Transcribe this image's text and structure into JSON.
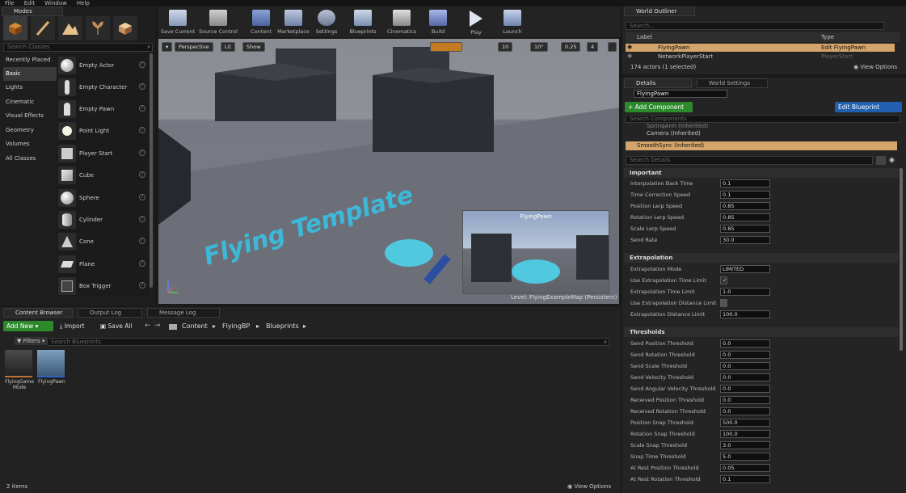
{
  "menubar": [
    "File",
    "Edit",
    "Window",
    "Help"
  ],
  "modes": {
    "tab": "Modes",
    "search_placeholder": "Search Classes",
    "categories": [
      "Recently Placed",
      "Basic",
      "Lights",
      "Cinematic",
      "Visual Effects",
      "Geometry",
      "Volumes",
      "All Classes"
    ],
    "items": [
      "Empty Actor",
      "Empty Character",
      "Empty Pawn",
      "Point Light",
      "Player Start",
      "Cube",
      "Sphere",
      "Cylinder",
      "Cone",
      "Plane",
      "Box Trigger"
    ]
  },
  "toolbar": [
    "Save Current",
    "Source Control",
    "Content",
    "Marketplace",
    "Settings",
    "Blueprints",
    "Cinematics",
    "Build",
    "Play",
    "Launch"
  ],
  "viewport": {
    "perspective": "Perspective",
    "lit": "Lit",
    "show": "Show",
    "grid": "10",
    "angle": "10°",
    "scale": "0.25",
    "cam": "4",
    "floor_text": "Flying Template",
    "pip_title": "FlyingPawn",
    "level_label": "Level:  FlyingExampleMap (Persistent)"
  },
  "outliner": {
    "tab": "World Outliner",
    "search_placeholder": "Search...",
    "col_label": "Label",
    "col_type": "Type",
    "rows": [
      {
        "label": "FlyingPawn",
        "type": "Edit FlyingPawn"
      },
      {
        "label": "NetworkPlayerStart",
        "type": "PlayerStart"
      }
    ],
    "count": "174 actors (1 selected)",
    "view_options": "View Options"
  },
  "details": {
    "tab": "Details",
    "tab2": "World Settings",
    "name": "FlyingPawn",
    "add_component": "+ Add Component",
    "edit_blueprint": "Edit Blueprint",
    "search_components": "Search Components",
    "components": [
      "SpringArm (Inherited)",
      "Camera (Inherited)",
      "SmoothSync (Inherited)"
    ],
    "search_details": "Search Details",
    "sections": {
      "important": "Important",
      "extrapolation": "Extrapolation",
      "thresholds": "Thresholds"
    },
    "important": [
      {
        "label": "Interpolation Back Time",
        "value": "0.1"
      },
      {
        "label": "Time Correction Speed",
        "value": "0.1"
      },
      {
        "label": "Position Lerp Speed",
        "value": "0.85"
      },
      {
        "label": "Rotation Lerp Speed",
        "value": "0.85"
      },
      {
        "label": "Scale Lerp Speed",
        "value": "0.85"
      },
      {
        "label": "Send Rate",
        "value": "30.0"
      }
    ],
    "extrapolation": [
      {
        "label": "Extrapolation Mode",
        "value": "LIMITED"
      },
      {
        "label": "Use Extrapolation Time Limit",
        "value": ""
      },
      {
        "label": "Extrapolation Time Limit",
        "value": "1.0"
      },
      {
        "label": "Use Extrapolation Distance Limit",
        "value": ""
      },
      {
        "label": "Extrapolation Distance Limit",
        "value": "100.0"
      }
    ],
    "thresholds": [
      {
        "label": "Send Position Threshold",
        "value": "0.0"
      },
      {
        "label": "Send Rotation Threshold",
        "value": "0.0"
      },
      {
        "label": "Send Scale Threshold",
        "value": "0.0"
      },
      {
        "label": "Send Velocity Threshold",
        "value": "0.0"
      },
      {
        "label": "Send Angular Velocity Threshold",
        "value": "0.0"
      },
      {
        "label": "Received Position Threshold",
        "value": "0.0"
      },
      {
        "label": "Received Rotation Threshold",
        "value": "0.0"
      },
      {
        "label": "Position Snap Threshold",
        "value": "500.0"
      },
      {
        "label": "Rotation Snap Threshold",
        "value": "100.0"
      },
      {
        "label": "Scale Snap Threshold",
        "value": "3.0"
      },
      {
        "label": "Snap Time Threshold",
        "value": "5.0"
      },
      {
        "label": "At Rest Position Threshold",
        "value": "0.05"
      },
      {
        "label": "At Rest Rotation Threshold",
        "value": "0.1"
      }
    ]
  },
  "content_browser": {
    "tabs": [
      "Content Browser",
      "Output Log",
      "Message Log"
    ],
    "add_new": "Add New",
    "import": "Import",
    "save_all": "Save All",
    "breadcrumb": [
      "Content",
      "FlyingBP",
      "Blueprints"
    ],
    "filters": "Filters",
    "search_placeholder": "Search Blueprints",
    "assets": [
      "FlyingGame Mode",
      "FlyingPawn"
    ],
    "count": "2 items",
    "view_options": "View Options"
  }
}
